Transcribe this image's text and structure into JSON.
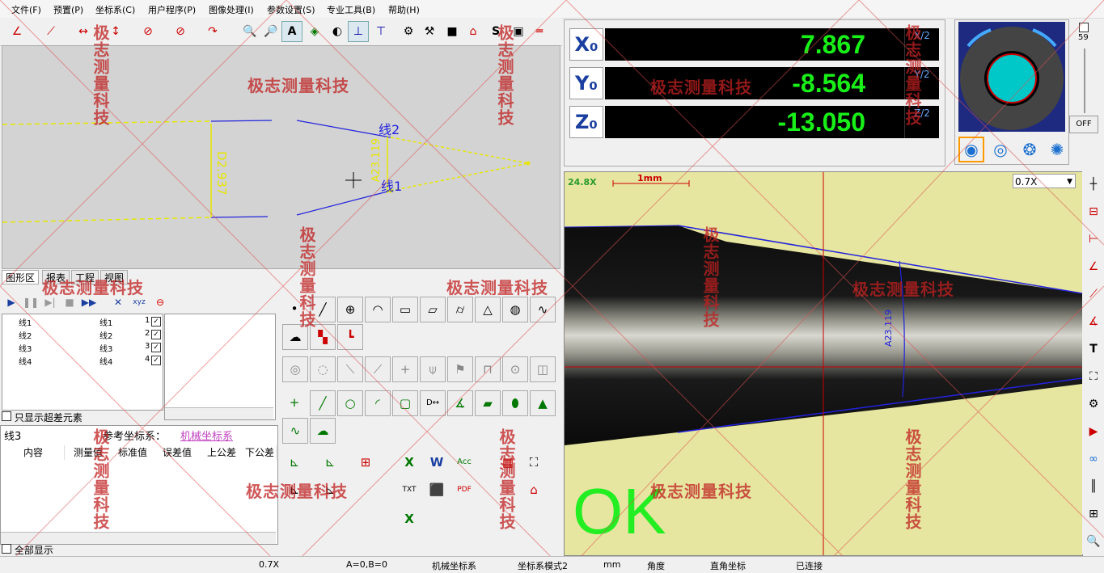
{
  "menu": [
    "文件(F)",
    "预置(P)",
    "坐标系(C)",
    "用户程序(P)",
    "图像处理(I)",
    "参数设置(S)",
    "专业工具(B)",
    "帮助(H)"
  ],
  "graphics": {
    "line2_label": "线2",
    "line1_label": "线1",
    "dim_d": "D2.937",
    "dim_a": "A23.119"
  },
  "tabs": [
    "图形区",
    "报表",
    "工程",
    "视图"
  ],
  "elements": [
    {
      "name": "线1",
      "type": "线1",
      "idx": "1"
    },
    {
      "name": "线2",
      "type": "线2",
      "idx": "2"
    },
    {
      "name": "线3",
      "type": "线3",
      "idx": "3"
    },
    {
      "name": "线4",
      "type": "线4",
      "idx": "4"
    }
  ],
  "only_out_of_tol": "只显示超差元素",
  "selected_element": "线3",
  "ref_coord_label": "参考坐标系：",
  "ref_coord_value": "机械坐标系",
  "result_headers": [
    "内容",
    "测量值",
    "标准值",
    "误差值",
    "上公差",
    "下公差"
  ],
  "show_all": "全部显示",
  "dro": {
    "x_label": "X₀",
    "x_value": "7.867",
    "x_half": "X/2",
    "y_label": "Y₀",
    "y_value": "-8.564",
    "y_half": "Y/2",
    "z_label": "Z₀",
    "z_value": "-13.050",
    "z_half": "Z/2"
  },
  "light": {
    "level": "59",
    "off_label": "OFF",
    "ring_color": "#444444",
    "center_color": "#00c8c8"
  },
  "camera": {
    "zoom_indicator": "24.8X",
    "scale_label": "1mm",
    "zoom_select": "0.7X",
    "angle_dim": "A23.119",
    "result": "OK",
    "result_color": "#22ee22"
  },
  "watermark": "极志测量科技",
  "status": [
    "0.7X",
    "A=0,B=0",
    "机械坐标系",
    "坐标系模式2",
    "mm",
    "角度",
    "直角坐标",
    "已连接"
  ]
}
